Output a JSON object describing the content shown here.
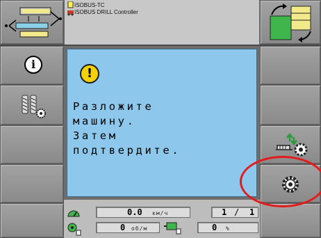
{
  "header": {
    "app_line1": "ISOBUS-TC",
    "app_line2": "ISOBUS DRILL Controller"
  },
  "dialog": {
    "icon": "warning-icon",
    "message": "Разложите\nмашину.\nЗатем\nподтвердите."
  },
  "left_softkeys": [
    {
      "icon": "info-icon"
    },
    {
      "icon": "machine-settings-icon"
    },
    {
      "icon": ""
    },
    {
      "icon": ""
    },
    {
      "icon": ""
    }
  ],
  "right_softkeys": [
    {
      "icon": ""
    },
    {
      "icon": ""
    },
    {
      "icon": "machine-unfold-icon"
    },
    {
      "icon": "settings-gear-icon"
    },
    {
      "icon": ""
    }
  ],
  "status": {
    "speed_value": "0.0",
    "speed_unit": "км/ч",
    "page": "1",
    "page_sep": "/",
    "page_total": "1",
    "rpm_value": "0",
    "rpm_unit": "об/м",
    "percent_value": "0",
    "percent_unit": "%"
  },
  "colors": {
    "dialog_bg": "#8dc8ec",
    "warning": "#f4d20a",
    "highlight_ring": "#e21b1b"
  }
}
